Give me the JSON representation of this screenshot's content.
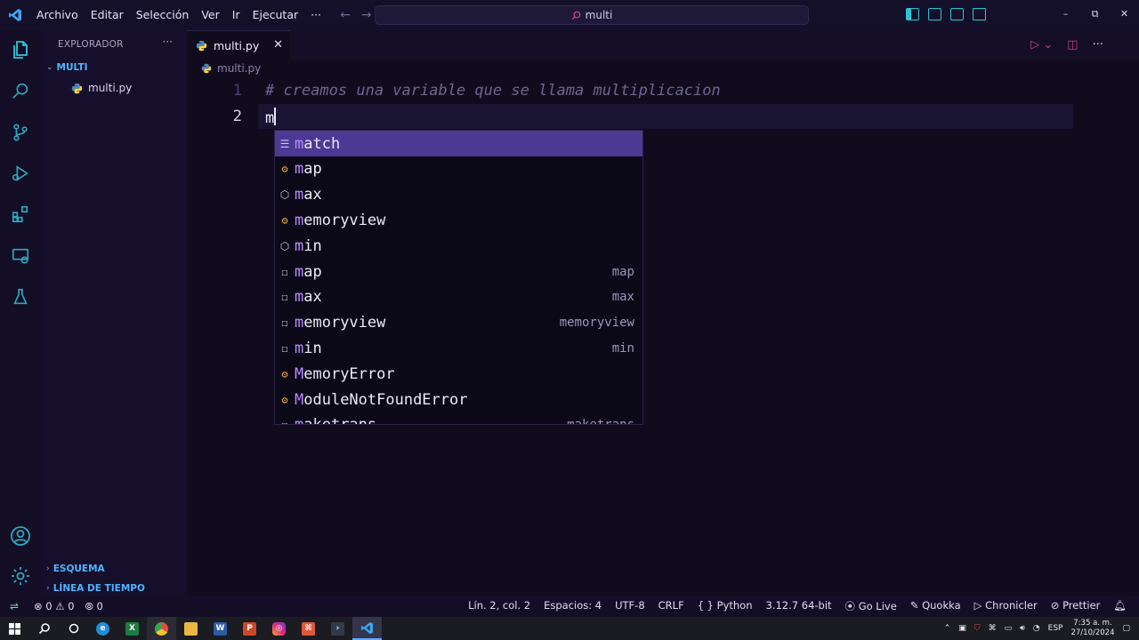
{
  "menu": [
    "Archivo",
    "Editar",
    "Selección",
    "Ver",
    "Ir",
    "Ejecutar",
    "···"
  ],
  "command_center": {
    "text": "multi"
  },
  "window_controls": {
    "minimize": "–",
    "restore": "⧉",
    "close": "✕"
  },
  "sidebar": {
    "title": "EXPLORADOR",
    "more": "···",
    "folder": "MULTI",
    "file": "multi.py",
    "outline": "ESQUEMA",
    "timeline": "LÍNEA DE TIEMPO"
  },
  "editor": {
    "tab_label": "multi.py",
    "breadcrumb": "multi.py",
    "lines": [
      {
        "number": "1",
        "text": "# creamos una variable que se llama multiplicacion"
      },
      {
        "number": "2",
        "text": "m"
      }
    ]
  },
  "suggestions": [
    {
      "kind": "keyword",
      "label": "match",
      "detail": ""
    },
    {
      "kind": "function",
      "label": "map",
      "detail": ""
    },
    {
      "kind": "class",
      "label": "max",
      "detail": ""
    },
    {
      "kind": "function",
      "label": "memoryview",
      "detail": ""
    },
    {
      "kind": "class",
      "label": "min",
      "detail": ""
    },
    {
      "kind": "snippet",
      "label": "map",
      "detail": "map"
    },
    {
      "kind": "snippet",
      "label": "max",
      "detail": "max"
    },
    {
      "kind": "snippet",
      "label": "memoryview",
      "detail": "memoryview"
    },
    {
      "kind": "snippet",
      "label": "min",
      "detail": "min"
    },
    {
      "kind": "function",
      "label": "MemoryError",
      "detail": ""
    },
    {
      "kind": "function",
      "label": "ModuleNotFoundError",
      "detail": ""
    },
    {
      "kind": "snippet",
      "label": "maketrans",
      "detail": "maketrans"
    }
  ],
  "status": {
    "errors": "0",
    "warnings": "0",
    "ports": "0",
    "position": "Lín. 2, col. 2",
    "spaces": "Espacios: 4",
    "encoding": "UTF-8",
    "eol": "CRLF",
    "language": "Python",
    "interpreter": "3.12.7 64-bit",
    "golive": "Go Live",
    "quokka": "Quokka",
    "chronicler": "Chronicler",
    "prettier": "Prettier"
  },
  "taskbar": {
    "lang": "ESP",
    "time": "7:35 a. m.",
    "date": "27/10/2024"
  },
  "colors": {
    "accent_cyan": "#2ec4d6",
    "selection": "#4a3a94",
    "highlight": "#b98cff"
  }
}
